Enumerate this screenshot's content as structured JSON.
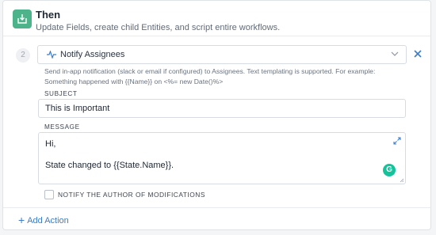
{
  "header": {
    "title": "Then",
    "subtitle": "Update Fields, create child Entities, and script entire workflows."
  },
  "step": {
    "number": "2",
    "action_select": {
      "value": "Notify Assignees",
      "icon": "pulse-icon"
    },
    "description": "Send in-app notification (slack or email if configured) to Assignees. Text templating is supported. For example: Something happened with {{Name}} on <%= new Date()%>",
    "subject": {
      "label": "SUBJECT",
      "value": "This is Important"
    },
    "message": {
      "label": "MESSAGE",
      "lines": [
        "Hi,",
        "",
        "State changed to {{State.Name}}."
      ]
    },
    "notify_author": {
      "label": "NOTIFY THE AUTHOR OF MODIFICATIONS",
      "checked": false
    }
  },
  "footer": {
    "add_action_label": "Add Action"
  },
  "colors": {
    "accent_green": "#4cb38b",
    "link_blue": "#3d7cc9",
    "grammarly": "#15c39a"
  }
}
